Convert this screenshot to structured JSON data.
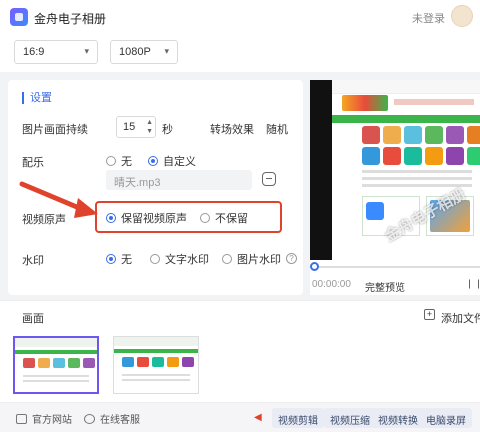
{
  "app": {
    "title": "金舟电子相册",
    "login": "未登录"
  },
  "toolbar": {
    "ratio": "16:9",
    "resolution": "1080P"
  },
  "settings": {
    "title": "设置",
    "duration_label": "图片画面持续",
    "duration_value": "15",
    "duration_unit": "秒",
    "transition_label": "转场效果",
    "transition_value": "随机",
    "music_label": "配乐",
    "music_options": [
      "无",
      "自定义"
    ],
    "music_selected": "自定义",
    "music_file": "晴天.mp3",
    "audio_label": "视频原声",
    "audio_options": [
      "保留视频原声",
      "不保留"
    ],
    "audio_selected": "保留视频原声",
    "watermark_label": "水印",
    "watermark_options": [
      "无",
      "文字水印",
      "图片水印"
    ],
    "watermark_selected": "无"
  },
  "preview": {
    "time": "00:00:00",
    "full_preview": "完整预览",
    "watermark_text": "金舟电子相册"
  },
  "frames": {
    "title": "画面",
    "add_label": "添加文件"
  },
  "footer": {
    "website": "官方网站",
    "support": "在线客服",
    "tools": [
      "视频剪辑",
      "视频压缩",
      "视频转换",
      "电脑录屏"
    ]
  },
  "colors": {
    "accent": "#3a6ee8",
    "highlight": "#e0432b",
    "frame_selected": "#6e56f0"
  }
}
